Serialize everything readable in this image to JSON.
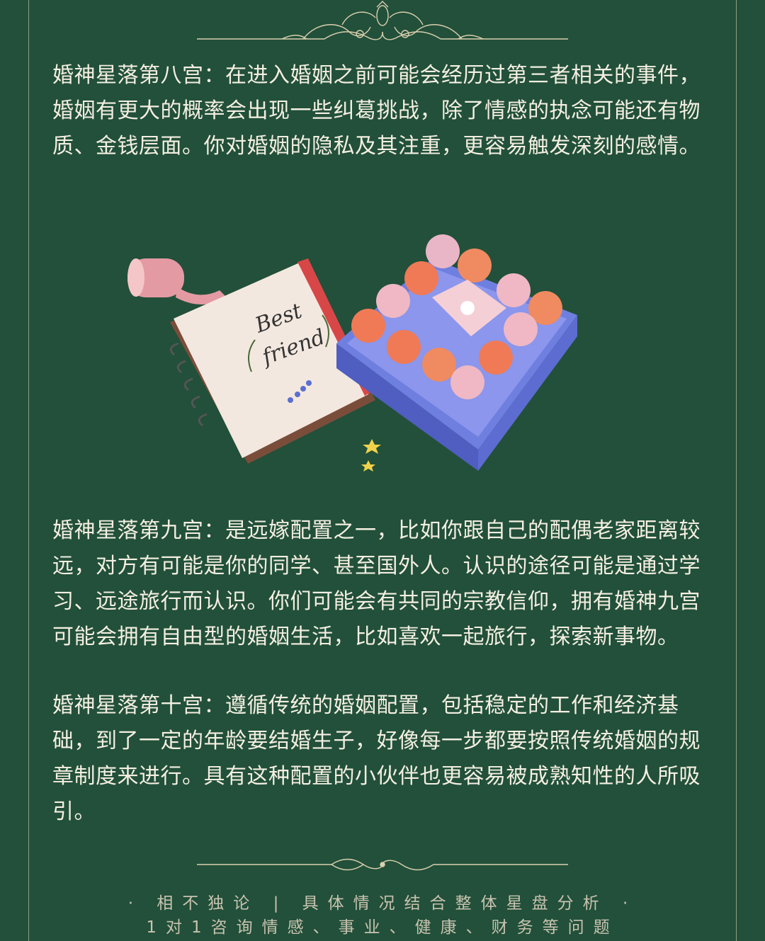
{
  "sections": [
    {
      "text": "婚神星落第八宫：在进入婚姻之前可能会经历过第三者相关的事件，婚姻有更大的概率会出现一些纠葛挑战，除了情感的执念可能还有物质、金钱层面。你对婚姻的隐私及其注重，更容易触发深刻的感情。"
    },
    {
      "text": "婚神星落第九宫：是远嫁配置之一，比如你跟自己的配偶老家距离较远，对方有可能是你的同学、甚至国外人。认识的途径可能是通过学习、远途旅行而认识。你们可能会有共同的宗教信仰，拥有婚神九宫可能会拥有自由型的婚姻生活，比如喜欢一起旅行，探索新事物。"
    },
    {
      "text": "婚神星落第十宫：遵循传统的婚姻配置，包括稳定的工作和经济基础，到了一定的年龄要结婚生子，好像每一步都要按照传统婚姻的规章制度来进行。具有这种配置的小伙伴也更容易被成熟知性的人所吸引。"
    }
  ],
  "illustration": {
    "notebook_text_line1": "Best",
    "notebook_text_line2": "friend"
  },
  "footer": {
    "line1": "· 相不独论 | 具体情况结合整体星盘分析 ·",
    "line2": "1对1咨询情感、事业、健康、财务等问题"
  },
  "colors": {
    "background": "#22503a",
    "text": "#f4efe2",
    "ornament": "#d9cfae"
  }
}
